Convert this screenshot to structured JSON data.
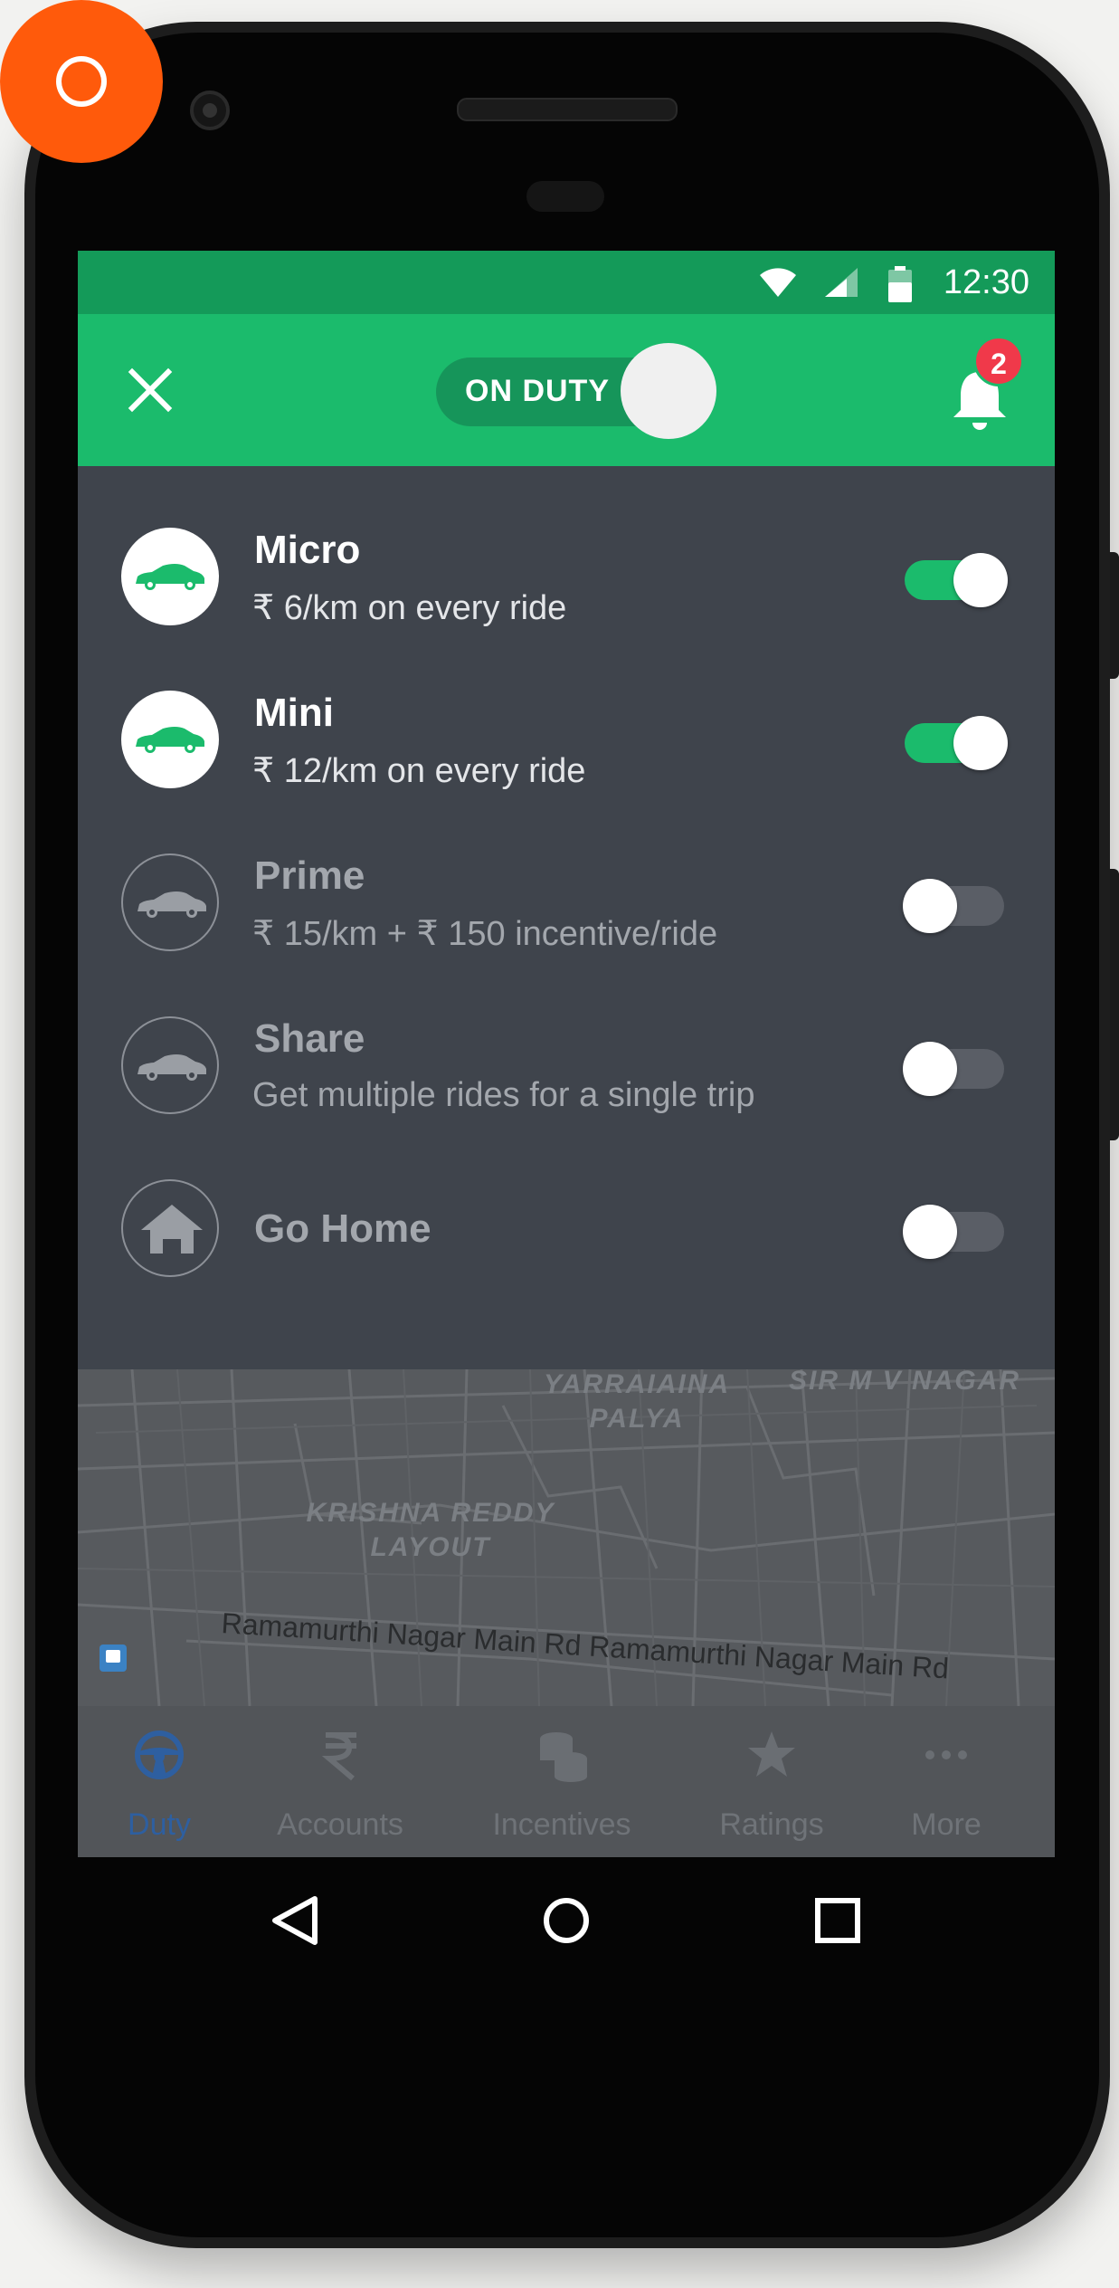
{
  "status_bar": {
    "time": "12:30"
  },
  "app_bar": {
    "duty_label": "ON DUTY",
    "duty_on": true,
    "notification_count": "2"
  },
  "categories": [
    {
      "icon": "car-icon",
      "title": "Micro",
      "subtitle": "₹ 6/km on every ride",
      "enabled": true
    },
    {
      "icon": "car-icon",
      "title": "Mini",
      "subtitle": "₹ 12/km on every ride",
      "enabled": true
    },
    {
      "icon": "car-icon",
      "title": "Prime",
      "subtitle": "₹ 15/km + ₹ 150 incentive/ride",
      "enabled": false
    },
    {
      "icon": "car-icon",
      "title": "Share",
      "subtitle": "Get multiple rides for a single trip",
      "enabled": false
    },
    {
      "icon": "home-icon",
      "title": "Go Home",
      "subtitle": "",
      "enabled": false
    }
  ],
  "map": {
    "areas": [
      "YARRAIAINA PALYA",
      "SIR M V NAGAR",
      "KRISHNA REDDY LAYOUT"
    ],
    "road": "Ramamurthi Nagar Main Rd Ramamurthi Nagar Main Rd"
  },
  "bottom_nav": [
    {
      "icon": "steering-wheel-icon",
      "label": "Duty",
      "active": true
    },
    {
      "icon": "rupee-icon",
      "label": "Accounts",
      "active": false
    },
    {
      "icon": "coins-icon",
      "label": "Incentives",
      "active": false
    },
    {
      "icon": "star-icon",
      "label": "Ratings",
      "active": false
    },
    {
      "icon": "more-dots-icon",
      "label": "More",
      "active": false
    }
  ],
  "colors": {
    "brand_green": "#1bbb6c",
    "status_green": "#149a59",
    "panel_bg": "#3f444c",
    "badge_red": "#f0394a",
    "active_nav": "#2e5fa0",
    "record_orange": "#ff5a0b"
  }
}
